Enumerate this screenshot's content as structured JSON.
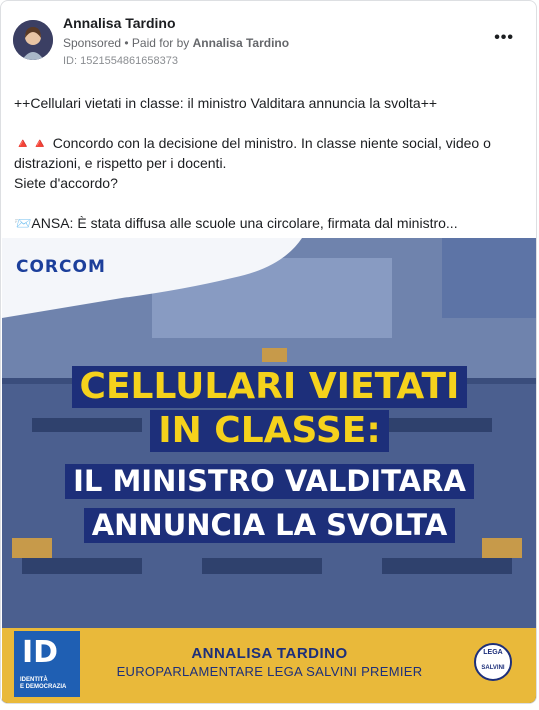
{
  "post": {
    "page_name": "Annalisa Tardino",
    "sponsored_label": "Sponsored",
    "paid_prefix": " • Paid for by ",
    "paid_by": "Annalisa Tardino",
    "ad_id": "ID: 1521554861658373",
    "more_icon": "more-options-icon",
    "text_line1": "++Cellulari vietati in classe: il ministro Valditara annuncia la svolta++",
    "text_line2a": "🔺🔺 Concordo con la decisione del ministro. In classe niente social, video o distrazioni, e rispetto per i docenti.",
    "text_line2b": "Siete d'accordo?",
    "text_line3": "📨ANSA: È stata diffusa alle scuole una circolare, firmata dal ministro..."
  },
  "creative": {
    "logo": "CORCOM",
    "headline": [
      "CELLULARI VIETATI",
      "IN CLASSE:"
    ],
    "subheadline": [
      "IL MINISTRO VALDITARA",
      "ANNUNCIA LA SVOLTA"
    ],
    "footer_name": "ANNALISA TARDINO",
    "footer_sub": "EUROPARLAMENTARE LEGA SALVINI PREMIER",
    "left_logo_caption": "IDENTITÀ\nE DEMOCRAZIA",
    "right_logo_top": "LEGA",
    "right_logo_bottom": "SALVINI",
    "colors": {
      "yellow": "#f5d21c",
      "navy": "#1d2f7a",
      "band": "#e9b93a"
    }
  }
}
